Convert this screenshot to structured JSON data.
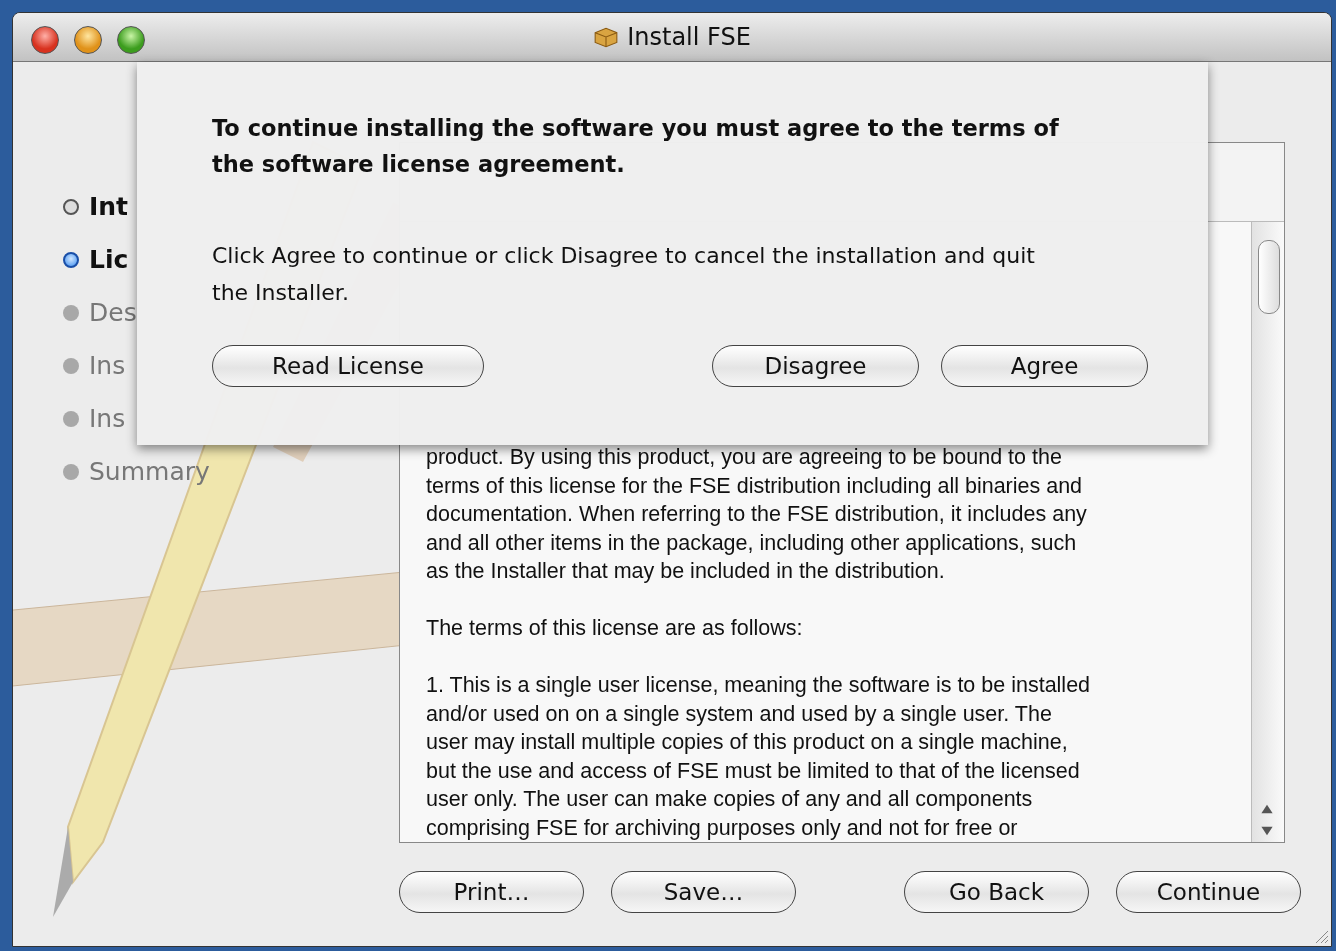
{
  "window": {
    "title": "Install FSE"
  },
  "steps": [
    {
      "label": "Int",
      "completed": true,
      "selected": false
    },
    {
      "label": "Lic",
      "completed": true,
      "selected": true
    },
    {
      "label": "Des",
      "completed": false,
      "selected": false
    },
    {
      "label": "Ins",
      "completed": false,
      "selected": false
    },
    {
      "label": "Ins",
      "completed": false,
      "selected": false
    },
    {
      "label": "Summary",
      "completed": false,
      "selected": false
    }
  ],
  "license": {
    "paragraphs": [
      [
        "product. By using this product, you are agreeing to be bound to the",
        "terms of this license for the FSE distribution including all binaries and",
        "documentation. When referring to the FSE distribution, it includes any",
        "and all other items in the package, including other applications, such",
        "as the Installer that may be included in the distribution."
      ],
      [
        "The terms of this license are as follows:"
      ],
      [
        "1. This is a single user license, meaning the software is to be installed",
        "and/or used on on a single system and used by a single user. The",
        "user may install multiple copies of this product on a single machine,",
        "but the use and access of FSE must be limited to that of the licensed",
        "user only. The user can make copies of any and all components",
        "comprising FSE for archiving purposes only and not for free or"
      ]
    ]
  },
  "buttons_left": [
    "Print…",
    "Save…"
  ],
  "buttons_right": [
    "Go Back",
    "Continue"
  ],
  "sheet": {
    "heading": "To continue installing the software you must agree to the terms of the software license agreement.",
    "message": "Click Agree to continue or click Disagree to cancel the installation and quit the Installer.",
    "buttons_left": [
      "Read License"
    ],
    "buttons_right": [
      "Disagree",
      "Agree"
    ]
  }
}
